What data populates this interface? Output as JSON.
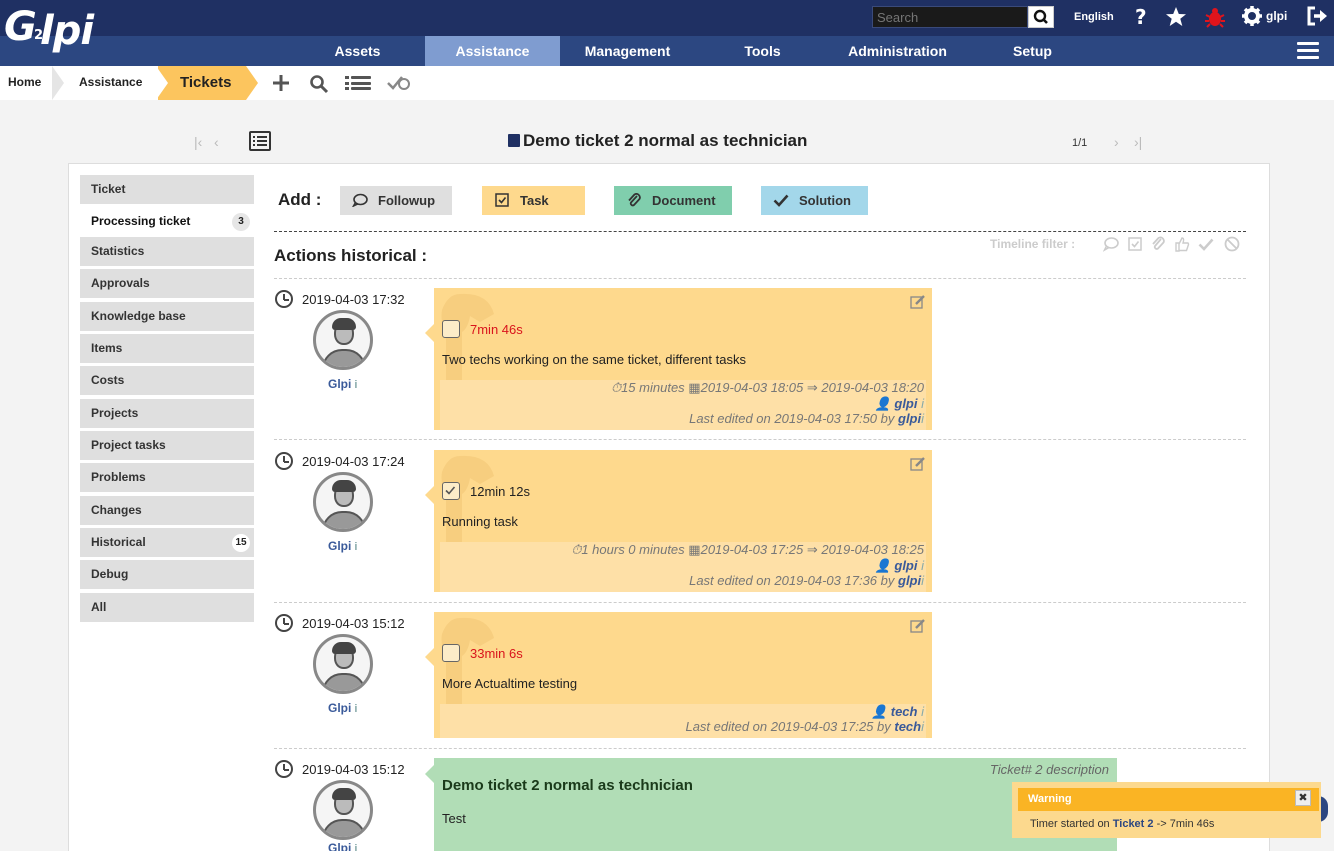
{
  "logo": {
    "letter": "G",
    "rest": "lpi",
    "small": "2"
  },
  "top": {
    "search_placeholder": "Search",
    "language": "English",
    "user": "glpi"
  },
  "menu": [
    "Assets",
    "Assistance",
    "Management",
    "Tools",
    "Administration",
    "Setup"
  ],
  "breadcrumb": {
    "home": "Home",
    "assistance": "Assistance",
    "tickets": "Tickets"
  },
  "page": {
    "title": "Demo ticket 2 normal as technician",
    "pager": "1/1"
  },
  "tabs": [
    {
      "label": "Ticket",
      "badge": ""
    },
    {
      "label": "Processing ticket",
      "badge": "3"
    },
    {
      "label": "Statistics",
      "badge": ""
    },
    {
      "label": "Approvals",
      "badge": ""
    },
    {
      "label": "Knowledge base",
      "badge": ""
    },
    {
      "label": "Items",
      "badge": ""
    },
    {
      "label": "Costs",
      "badge": ""
    },
    {
      "label": "Projects",
      "badge": ""
    },
    {
      "label": "Project tasks",
      "badge": ""
    },
    {
      "label": "Problems",
      "badge": ""
    },
    {
      "label": "Changes",
      "badge": ""
    },
    {
      "label": "Historical",
      "badge": "15"
    },
    {
      "label": "Debug",
      "badge": ""
    },
    {
      "label": "All",
      "badge": ""
    }
  ],
  "add": {
    "label": "Add :",
    "followup": "Followup",
    "task": "Task",
    "document": "Document",
    "solution": "Solution"
  },
  "timeline": {
    "title": "Actions historical :",
    "filter_label": "Timeline filter :",
    "items": [
      {
        "date": "2019-04-03 17:32",
        "author": "Glpi",
        "info": "i",
        "duration": "7min 46s",
        "content": "Two techs working on the same ticket, different tasks",
        "planned": "15 minutes",
        "period": "2019-04-03 18:05 ⇒ 2019-04-03 18:20",
        "user": "glpi",
        "edited": "Last edited on 2019-04-03 17:50 by",
        "editor": "glpi"
      },
      {
        "date": "2019-04-03 17:24",
        "author": "Glpi",
        "info": "i",
        "duration": "12min 12s",
        "content": "Running task",
        "planned": "1 hours 0 minutes",
        "period": "2019-04-03 17:25 ⇒ 2019-04-03 18:25",
        "user": "glpi",
        "edited": "Last edited on 2019-04-03 17:36 by",
        "editor": "glpi"
      },
      {
        "date": "2019-04-03 15:12",
        "author": "Glpi",
        "info": "i",
        "duration": "33min 6s",
        "content": "More Actualtime testing",
        "user": "tech",
        "edited": "Last edited on 2019-04-03 17:25 by",
        "editor": "tech"
      },
      {
        "date": "2019-04-03 15:12",
        "author": "Glpi",
        "info": "i",
        "desc_label": "Ticket# 2 description",
        "desc_title": "Demo ticket 2 normal as technician",
        "desc_content": "Test"
      }
    ]
  },
  "toast": {
    "title": "Warning",
    "close": "✖",
    "msg_prefix": "Timer started on",
    "link": "Ticket 2",
    "msg_suffix": "-> 7min 46s"
  },
  "colors": {
    "topbar": "#1f3063",
    "menubar": "#2c4781",
    "menu_active": "#7f9cd0",
    "task": "#fed98d",
    "followup": "#dfdfdf",
    "document": "#80cead",
    "solution": "#a3d7ea",
    "description": "#b1ddb6",
    "warning": "#fab424"
  }
}
